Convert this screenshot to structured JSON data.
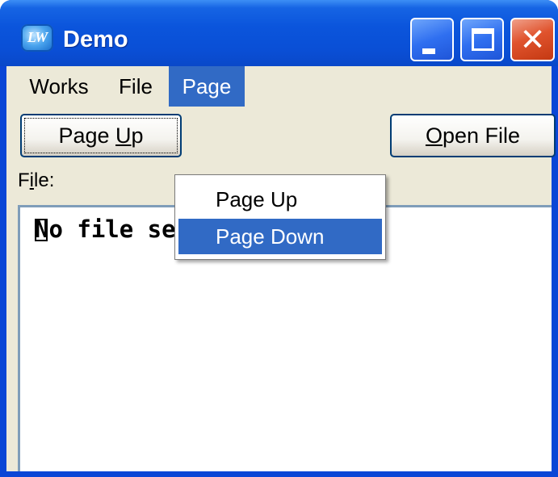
{
  "window": {
    "title": "Demo",
    "icon_letters": "LW",
    "icon": "app-icon",
    "buttons": {
      "minimize_icon": "minimize-icon",
      "maximize_icon": "maximize-icon",
      "close_glyph": "✕"
    }
  },
  "menubar": {
    "items": [
      {
        "label": "Works"
      },
      {
        "label": "File"
      },
      {
        "label": "Page",
        "active": true
      }
    ]
  },
  "page_menu": {
    "items": [
      {
        "label": "Page Up"
      },
      {
        "label": "Page Down",
        "highlighted": true
      }
    ]
  },
  "toolbar": {
    "page_up": {
      "pre": "Page ",
      "mnemonic": "U",
      "post": "p"
    },
    "open_file": {
      "pre": "",
      "mnemonic": "O",
      "post": "pen File"
    }
  },
  "file_label": {
    "pre": "F",
    "mnemonic": "i",
    "post": "le:"
  },
  "textarea": {
    "value": "No file selected."
  },
  "colors": {
    "titlebar": "#0a4fd6",
    "selection": "#316ac5",
    "client_bg": "#ece9d8",
    "close_button": "#e0532d"
  }
}
